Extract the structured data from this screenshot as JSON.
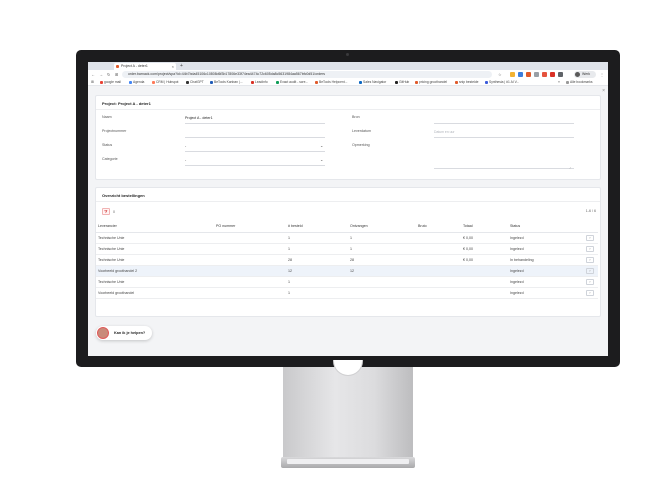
{
  "browser": {
    "tab_title": "Project A - deter1",
    "tab_close": "×",
    "new_tab": "+",
    "url": "order.barnack.com/project/spa?id=44b7bda45106c10808d6f3b17806e33f74ea4474c72c605da8c5631984aa567bfc0d51/orders",
    "profile_label": "Werk",
    "bookmarks": [
      "google mail",
      "Agenda",
      "CRM | Hubspot",
      "ChatGPT",
      "BeTools Kanban |...",
      "Leadinfo",
      "Exact audit - scre...",
      "BeTools Helpcent...",
      "Sales Navigator",
      "GitHub",
      "pricing groothandel",
      "snip bestelde",
      "Synthesia | #1 AI V..."
    ],
    "all_bookmarks": "Alle bookmarks",
    "colors": {
      "accent": "#e05a2b"
    }
  },
  "project": {
    "title": "Project: Project A - deter1",
    "close_icon": "×",
    "fields": {
      "naam_label": "Naam",
      "naam_value": "Project A - deter1",
      "projectnummer_label": "Projectnummer",
      "status_label": "Status",
      "status_value": "-",
      "categorie_label": "Categorie",
      "categorie_value": "-",
      "bron_label": "Bron",
      "leverdatum_label": "Leverdatum",
      "leverdatum_placeholder": "Datum en uur",
      "opmerking_label": "Opmerking"
    }
  },
  "orders": {
    "title": "Overzicht bestellingen",
    "filter_count": "0",
    "pager": "1-6 / 6",
    "columns": [
      "Leverancier",
      "PO nummer",
      "# besteld",
      "Ontvangen",
      "Bruto",
      "Totaal",
      "Status"
    ],
    "rows": [
      {
        "leverancier": "Technische Unie",
        "po": "",
        "besteld": "1",
        "ontvangen": "1",
        "bruto": "",
        "totaal": "€ 0,00",
        "status": "Ingelezd"
      },
      {
        "leverancier": "Technische Unie",
        "po": "",
        "besteld": "1",
        "ontvangen": "1",
        "bruto": "",
        "totaal": "€ 0,00",
        "status": "Ingelezd"
      },
      {
        "leverancier": "Technische Unie",
        "po": "",
        "besteld": "28",
        "ontvangen": "28",
        "bruto": "",
        "totaal": "€ 0,00",
        "status": "In behandeling"
      },
      {
        "leverancier": "Voorbeeld groothandel 2",
        "po": "",
        "besteld": "12",
        "ontvangen": "12",
        "bruto": "",
        "totaal": "",
        "status": "Ingelezd"
      },
      {
        "leverancier": "Technische Unie",
        "po": "",
        "besteld": "1",
        "ontvangen": "",
        "bruto": "",
        "totaal": "",
        "status": "Ingelezd"
      },
      {
        "leverancier": "Voorbeeld groothandel",
        "po": "",
        "besteld": "1",
        "ontvangen": "",
        "bruto": "",
        "totaal": "",
        "status": "Ingelezd"
      }
    ],
    "row_action": "›"
  },
  "chat": {
    "label": "Kan ik je helpen?"
  }
}
